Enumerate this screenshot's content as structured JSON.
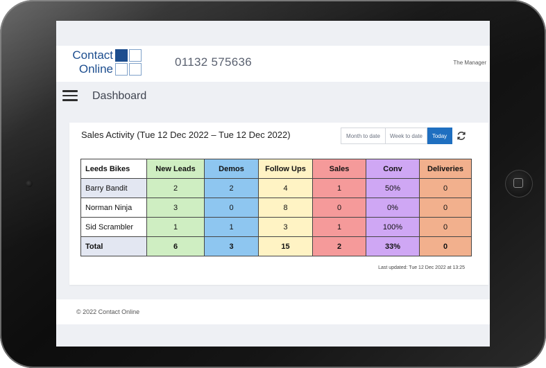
{
  "header": {
    "logo_line1": "Contact",
    "logo_line2": "Online",
    "phone": "01132 575636",
    "user": "The Manager"
  },
  "nav": {
    "page_title": "Dashboard"
  },
  "sales_activity": {
    "title": "Sales Activity (Tue 12 Dec 2022 – Tue 12 Dec 2022)",
    "filters": [
      "Month to date",
      "Week to date",
      "Today"
    ],
    "active_filter": "Today",
    "columns": [
      "Leeds Bikes",
      "New Leads",
      "Demos",
      "Follow Ups",
      "Sales",
      "Conv",
      "Deliveries"
    ],
    "rows": [
      [
        "Barry Bandit",
        "2",
        "2",
        "4",
        "1",
        "50%",
        "0"
      ],
      [
        "Norman Ninja",
        "3",
        "0",
        "8",
        "0",
        "0%",
        "0"
      ],
      [
        "Sid Scrambler",
        "1",
        "1",
        "3",
        "1",
        "100%",
        "0"
      ]
    ],
    "total": [
      "Total",
      "6",
      "3",
      "15",
      "2",
      "33%",
      "0"
    ],
    "last_updated": "Last updated: Tue 12 Dec 2022 at 13:25"
  },
  "footer": {
    "text": "© 2022 Contact Online"
  },
  "colors": {
    "brand": "#1d4e8f",
    "active_button": "#1f6fc0",
    "new_leads": "#cfeec2",
    "demos": "#8ec6f0",
    "follow_ups": "#fff3c4",
    "sales": "#f59a9a",
    "conv": "#cfa7f4",
    "deliveries": "#f2b08d"
  },
  "icons": {
    "menu": "hamburger-icon",
    "refresh": "refresh-icon",
    "home": "home-button-icon",
    "camera": "camera-icon"
  }
}
